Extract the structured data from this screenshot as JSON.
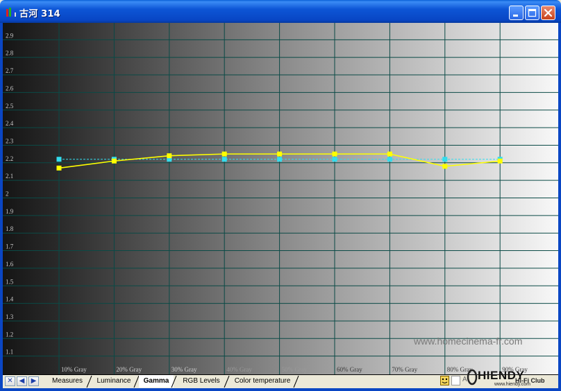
{
  "window": {
    "title": "古河 314",
    "minimize_icon": "minimize-icon",
    "maximize_icon": "maximize-icon",
    "close_icon": "close-icon",
    "app_icon": "bar-chart-app-icon"
  },
  "tabs": [
    {
      "label": "Measures",
      "active": false
    },
    {
      "label": "Luminance",
      "active": false
    },
    {
      "label": "Gamma",
      "active": true
    },
    {
      "label": "RGB Levels",
      "active": false
    },
    {
      "label": "Color temperature",
      "active": false
    }
  ],
  "nav_buttons": [
    {
      "glyph": "✕",
      "icon": "close-icon"
    },
    {
      "glyph": "◀",
      "icon": "arrow-left-icon"
    },
    {
      "glyph": "▶",
      "icon": "arrow-right-icon"
    }
  ],
  "watermarks": {
    "site": "www.homecinema-fr.com",
    "brand": "HIENDY",
    "brand_sub": "Hi-Fi Club",
    "brand_url": "www.hiendy.com"
  },
  "colors": {
    "measured_line": "#ffff00",
    "reference_line": "#33ddee",
    "grid": "#0a4a46"
  },
  "chart_data": {
    "type": "line",
    "title": "",
    "xlabel": "",
    "ylabel": "",
    "categories": [
      "10% Gray",
      "20% Gray",
      "30% Gray",
      "40% Gray",
      "50% Gray",
      "60% Gray",
      "70% Gray",
      "80% Gray",
      "90% Gray"
    ],
    "y_ticks": [
      1.1,
      1.2,
      1.3,
      1.4,
      1.5,
      1.6,
      1.7,
      1.8,
      1.9,
      2,
      2.1,
      2.2,
      2.3,
      2.4,
      2.5,
      2.6,
      2.7,
      2.8,
      2.9
    ],
    "y_tick_labels": [
      "1.1",
      "1.2",
      "1.3",
      "1.4",
      "1.5",
      "1.6",
      "1.7",
      "1.8",
      "1.9",
      "2",
      "2.1",
      "2.2",
      "2.3",
      "2.4",
      "2.5",
      "2.6",
      "2.7",
      "2.8",
      "2.9"
    ],
    "ylim": [
      1.0,
      3.0
    ],
    "grid": true,
    "legend": "none",
    "background": "grayscale-gradient",
    "series": [
      {
        "color": "#ffff00",
        "values": [
          2.17,
          2.21,
          2.24,
          2.25,
          2.25,
          2.25,
          2.25,
          2.18,
          2.21
        ]
      },
      {
        "color": "#33ddee",
        "values": [
          2.22,
          2.22,
          2.22,
          2.22,
          2.22,
          2.22,
          2.22,
          2.22,
          2.22
        ]
      }
    ]
  }
}
